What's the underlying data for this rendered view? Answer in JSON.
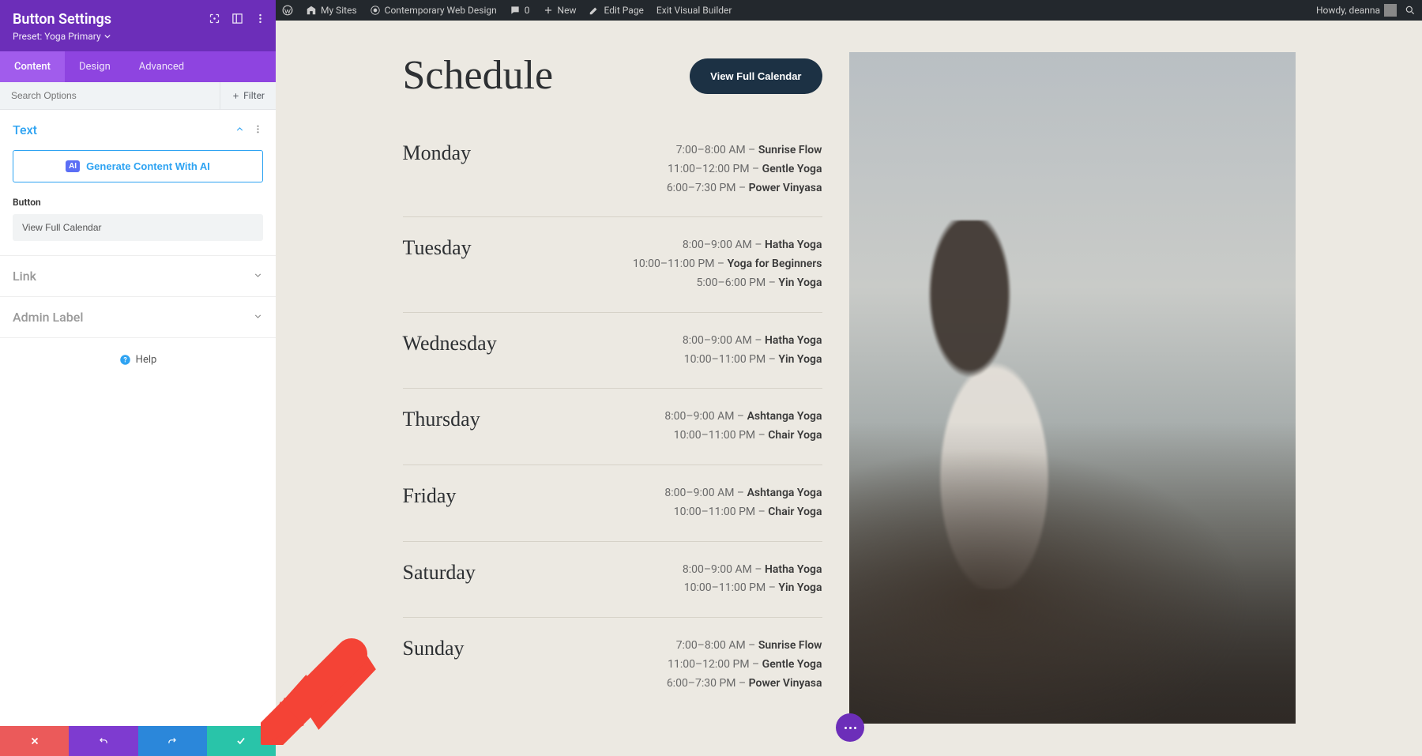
{
  "wpbar": {
    "my_sites": "My Sites",
    "site_title": "Contemporary Web Design",
    "comments": "0",
    "new": "New",
    "edit_page": "Edit Page",
    "exit_builder": "Exit Visual Builder",
    "greeting": "Howdy, deanna"
  },
  "panel": {
    "title": "Button Settings",
    "preset": "Preset: Yoga Primary",
    "tabs": {
      "content": "Content",
      "design": "Design",
      "advanced": "Advanced"
    },
    "search_placeholder": "Search Options",
    "filter": "Filter",
    "sections": {
      "text": "Text",
      "link": "Link",
      "admin_label": "Admin Label"
    },
    "ai_button": "Generate Content With AI",
    "ai_badge": "AI",
    "button_label": "Button",
    "button_value": "View Full Calendar",
    "help": "Help"
  },
  "page": {
    "title": "Schedule",
    "view_full": "View Full Calendar",
    "days": [
      {
        "name": "Monday",
        "slots": [
          {
            "time": "7:00–8:00 AM",
            "class": "Sunrise Flow"
          },
          {
            "time": "11:00–12:00 PM",
            "class": "Gentle Yoga"
          },
          {
            "time": "6:00–7:30 PM",
            "class": "Power Vinyasa"
          }
        ]
      },
      {
        "name": "Tuesday",
        "slots": [
          {
            "time": "8:00–9:00 AM",
            "class": "Hatha Yoga"
          },
          {
            "time": "10:00–11:00 PM",
            "class": "Yoga for Beginners"
          },
          {
            "time": "5:00–6:00 PM",
            "class": "Yin Yoga"
          }
        ]
      },
      {
        "name": "Wednesday",
        "slots": [
          {
            "time": "8:00–9:00 AM",
            "class": "Hatha Yoga"
          },
          {
            "time": "10:00–11:00 PM",
            "class": "Yin Yoga"
          }
        ]
      },
      {
        "name": "Thursday",
        "slots": [
          {
            "time": "8:00–9:00 AM",
            "class": "Ashtanga Yoga"
          },
          {
            "time": "10:00–11:00 PM",
            "class": "Chair Yoga"
          }
        ]
      },
      {
        "name": "Friday",
        "slots": [
          {
            "time": "8:00–9:00 AM",
            "class": "Ashtanga Yoga"
          },
          {
            "time": "10:00–11:00 PM",
            "class": "Chair Yoga"
          }
        ]
      },
      {
        "name": "Saturday",
        "slots": [
          {
            "time": "8:00–9:00 AM",
            "class": "Hatha Yoga"
          },
          {
            "time": "10:00–11:00 PM",
            "class": "Yin Yoga"
          }
        ]
      },
      {
        "name": "Sunday",
        "slots": [
          {
            "time": "7:00–8:00 AM",
            "class": "Sunrise Flow"
          },
          {
            "time": "11:00–12:00 PM",
            "class": "Gentle Yoga"
          },
          {
            "time": "6:00–7:30 PM",
            "class": "Power Vinyasa"
          }
        ]
      }
    ]
  }
}
